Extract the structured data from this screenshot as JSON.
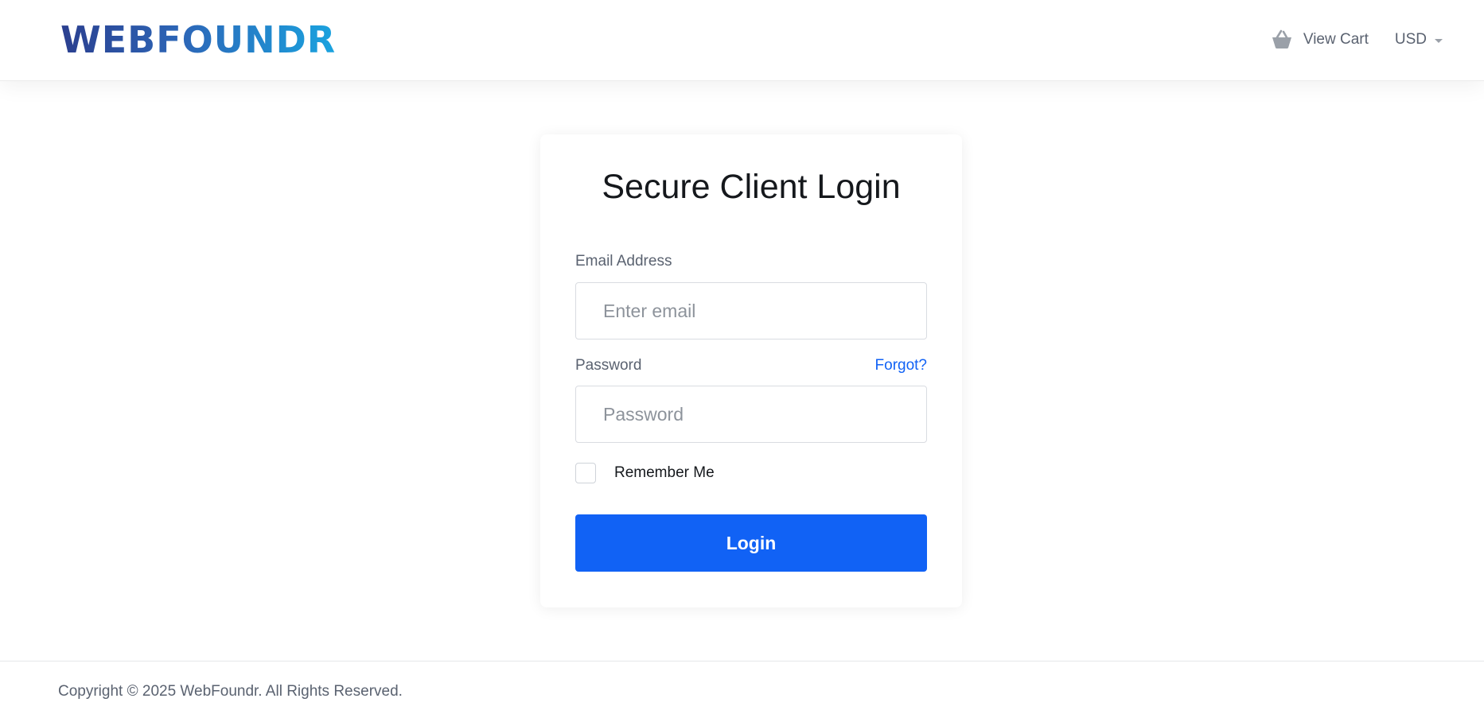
{
  "header": {
    "logo_text": "WEBFOUNDR",
    "cart_label": "View Cart",
    "cart_icon": "basket-icon",
    "currency_label": "USD",
    "currency_icon": "caret-down-icon"
  },
  "login_card": {
    "title": "Secure Client Login",
    "email": {
      "label": "Email Address",
      "placeholder": "Enter email",
      "value": ""
    },
    "password": {
      "label": "Password",
      "placeholder": "Password",
      "value": "",
      "forgot_label": "Forgot?"
    },
    "remember_me": {
      "label": "Remember Me",
      "checked": false
    },
    "login_button_label": "Login"
  },
  "footer": {
    "copyright": "Copyright © 2025 WebFoundr. All Rights Reserved."
  },
  "colors": {
    "primary": "#1162f5",
    "text_dark": "#15181c",
    "text_muted": "#5a6270",
    "logo_gradient_start": "#2b3f8f",
    "logo_gradient_end": "#1aa3df"
  }
}
